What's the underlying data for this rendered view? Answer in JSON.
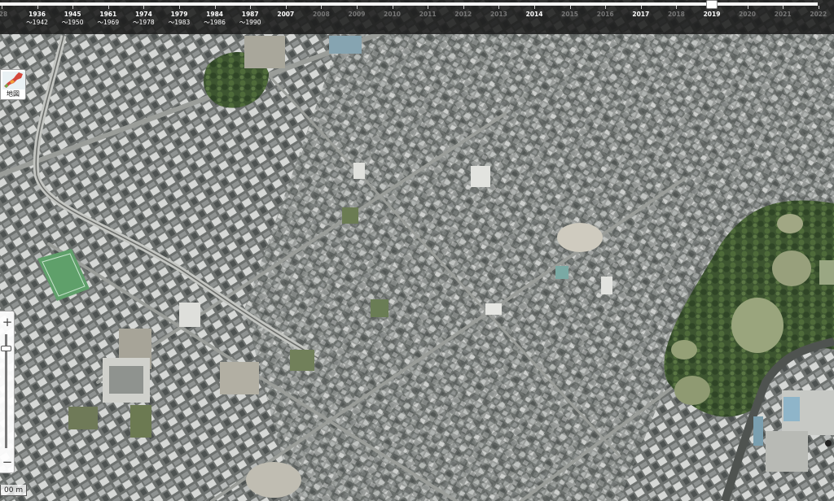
{
  "timeline": {
    "years": [
      {
        "label": "28",
        "to": "",
        "active": false
      },
      {
        "label": "1936",
        "to": "〜1942",
        "active": true
      },
      {
        "label": "1945",
        "to": "〜1950",
        "active": true
      },
      {
        "label": "1961",
        "to": "〜1969",
        "active": true
      },
      {
        "label": "1974",
        "to": "〜1978",
        "active": true
      },
      {
        "label": "1979",
        "to": "〜1983",
        "active": true
      },
      {
        "label": "1984",
        "to": "〜1986",
        "active": true
      },
      {
        "label": "1987",
        "to": "〜1990",
        "active": true
      },
      {
        "label": "2007",
        "to": "",
        "active": true
      },
      {
        "label": "2008",
        "to": "",
        "active": false
      },
      {
        "label": "2009",
        "to": "",
        "active": false
      },
      {
        "label": "2010",
        "to": "",
        "active": false
      },
      {
        "label": "2011",
        "to": "",
        "active": false
      },
      {
        "label": "2012",
        "to": "",
        "active": false
      },
      {
        "label": "2013",
        "to": "",
        "active": false
      },
      {
        "label": "2014",
        "to": "",
        "active": true
      },
      {
        "label": "2015",
        "to": "",
        "active": false
      },
      {
        "label": "2016",
        "to": "",
        "active": false
      },
      {
        "label": "2017",
        "to": "",
        "active": true
      },
      {
        "label": "2018",
        "to": "",
        "active": false
      },
      {
        "label": "2019",
        "to": "",
        "active": true
      },
      {
        "label": "2020",
        "to": "",
        "active": false
      },
      {
        "label": "2021",
        "to": "",
        "active": false
      },
      {
        "label": "2022",
        "to": "",
        "active": false
      }
    ],
    "selected_year": "2019"
  },
  "map_type": {
    "label": "地図",
    "icon": "japan-map-icon"
  },
  "zoom": {
    "in_label": "+",
    "out_label": "−",
    "level_fraction": 0.1
  },
  "scale": {
    "label": "00 m"
  },
  "colors": {
    "bar_bg": "#1c1c1c",
    "active_year": "#ffffff",
    "inactive_year": "#777777",
    "vegetation": "#3f5a2c",
    "field": "#5fa06a"
  }
}
